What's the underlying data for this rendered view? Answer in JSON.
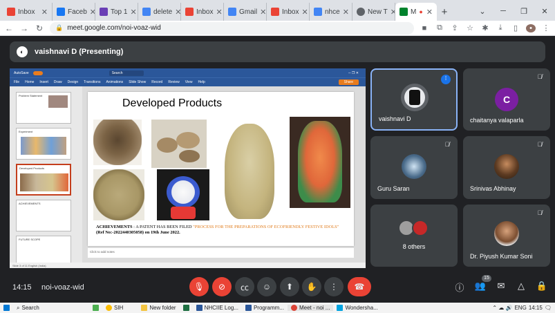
{
  "browser": {
    "tabs": [
      {
        "label": "Inbox",
        "color": "#ea4335",
        "active": false
      },
      {
        "label": "Faceb",
        "color": "#1877f2",
        "active": false
      },
      {
        "label": "Top 1",
        "color": "#6a3fb5",
        "active": false
      },
      {
        "label": "delete",
        "color": "#4285f4",
        "active": false
      },
      {
        "label": "Inbox",
        "color": "#ea4335",
        "active": false
      },
      {
        "label": "Gmail",
        "color": "#4285f4",
        "active": false
      },
      {
        "label": "Inbox",
        "color": "#ea4335",
        "active": false
      },
      {
        "label": "nhce",
        "color": "#4285f4",
        "active": false
      },
      {
        "label": "New T",
        "color": "#5f6368",
        "active": false
      },
      {
        "label": "M",
        "color": "#00832d",
        "active": true
      }
    ],
    "new_tab": "+",
    "url": "meet.google.com/noi-voaz-wid"
  },
  "meet": {
    "presenting_label": "vaishnavi D (Presenting)",
    "slide": {
      "title": "Developed Products",
      "ach_label": "ACHIEVEMENTS",
      "ach_text": ": A PATENT HAS BEEN FILED",
      "ach_orange": "\"PROCESS FOR THE PREPARATIONS OF ECOFRIENDLY FESTIVE IDOLS\"",
      "ach_ref": "(Ref No:-202244030505​8) on 19th June 2022.",
      "notes_placeholder": "Click to add notes"
    },
    "ppt": {
      "search": "Search",
      "menu": [
        "File",
        "Home",
        "Insert",
        "Draw",
        "Design",
        "Transitions",
        "Animations",
        "Slide Show",
        "Record",
        "Review",
        "View",
        "Help"
      ],
      "status_left": "Slide 3 of 11   English (India)",
      "thumb_titles": [
        "Problem Statement",
        "Experiment",
        "Developed Products",
        "ACHIEVEMENTS",
        "FUTURE SCOPE"
      ]
    },
    "participants": [
      {
        "name": "vaishnavi D",
        "initial": "",
        "active": true
      },
      {
        "name": "chaitanya valaparla",
        "initial": "C",
        "active": false
      },
      {
        "name": "Guru Saran",
        "initial": "",
        "active": false
      },
      {
        "name": "Srinivas Abhinay",
        "initial": "",
        "active": false
      },
      {
        "name": "8 others",
        "initial": "",
        "active": false
      },
      {
        "name": "Dr. Piyush Kumar Soni",
        "initial": "",
        "active": false
      }
    ],
    "time": "14:15",
    "meeting_code": "noi-voaz-wid",
    "people_count": "15"
  },
  "taskbar": {
    "search": "Search",
    "items": [
      "SIH",
      "New folder",
      "NHCIIE Log...",
      "Programm...",
      "Meet - noi ...",
      "Wondersha..."
    ],
    "lang": "ENG",
    "time": "14:15"
  }
}
